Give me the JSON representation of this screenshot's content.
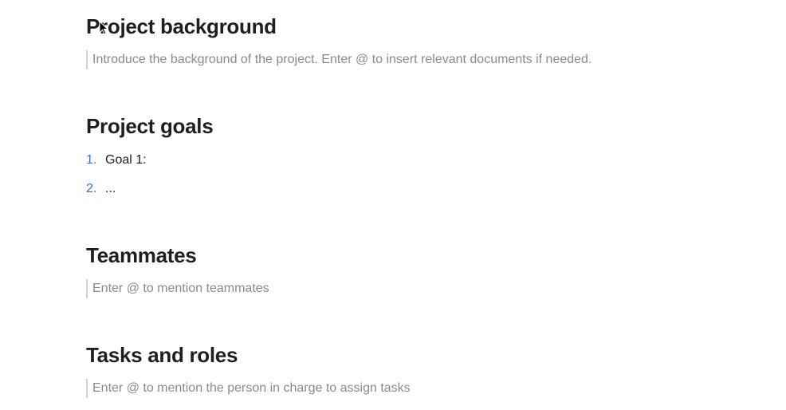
{
  "sections": {
    "background": {
      "heading": "Project background",
      "placeholder": "Introduce the background of the project. Enter @ to insert relevant documents if needed."
    },
    "goals": {
      "heading": "Project goals",
      "items": [
        "Goal 1:",
        "..."
      ]
    },
    "teammates": {
      "heading": "Teammates",
      "placeholder": "Enter @ to mention teammates"
    },
    "tasks": {
      "heading": "Tasks and roles",
      "placeholder": "Enter @ to mention the person in charge to assign tasks"
    }
  }
}
